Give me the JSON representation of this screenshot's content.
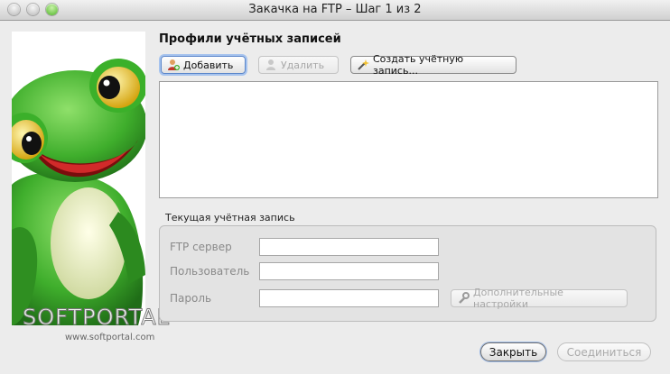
{
  "window": {
    "title": "Закачка на FTP – Шаг 1 из 2"
  },
  "profiles": {
    "title": "Профили учётных записей",
    "add_label": "Добавить",
    "delete_label": "Удалить",
    "create_label": "Создать учётную запись..."
  },
  "current_account": {
    "group_label": "Текущая учётная запись",
    "ftp_server_label": "FTP сервер",
    "username_label": "Пользователь",
    "password_label": "Пароль",
    "ftp_server_value": "",
    "username_value": "",
    "password_value": "",
    "advanced_label": "Дополнительные настройки"
  },
  "footer": {
    "close_label": "Закрыть",
    "connect_label": "Соединиться"
  },
  "watermark": {
    "brand": "SOFTPORTAL",
    "url": "www.softportal.com"
  },
  "colors": {
    "frog_green": "#3fae2c",
    "focus_ring": "#a6c3ee"
  }
}
